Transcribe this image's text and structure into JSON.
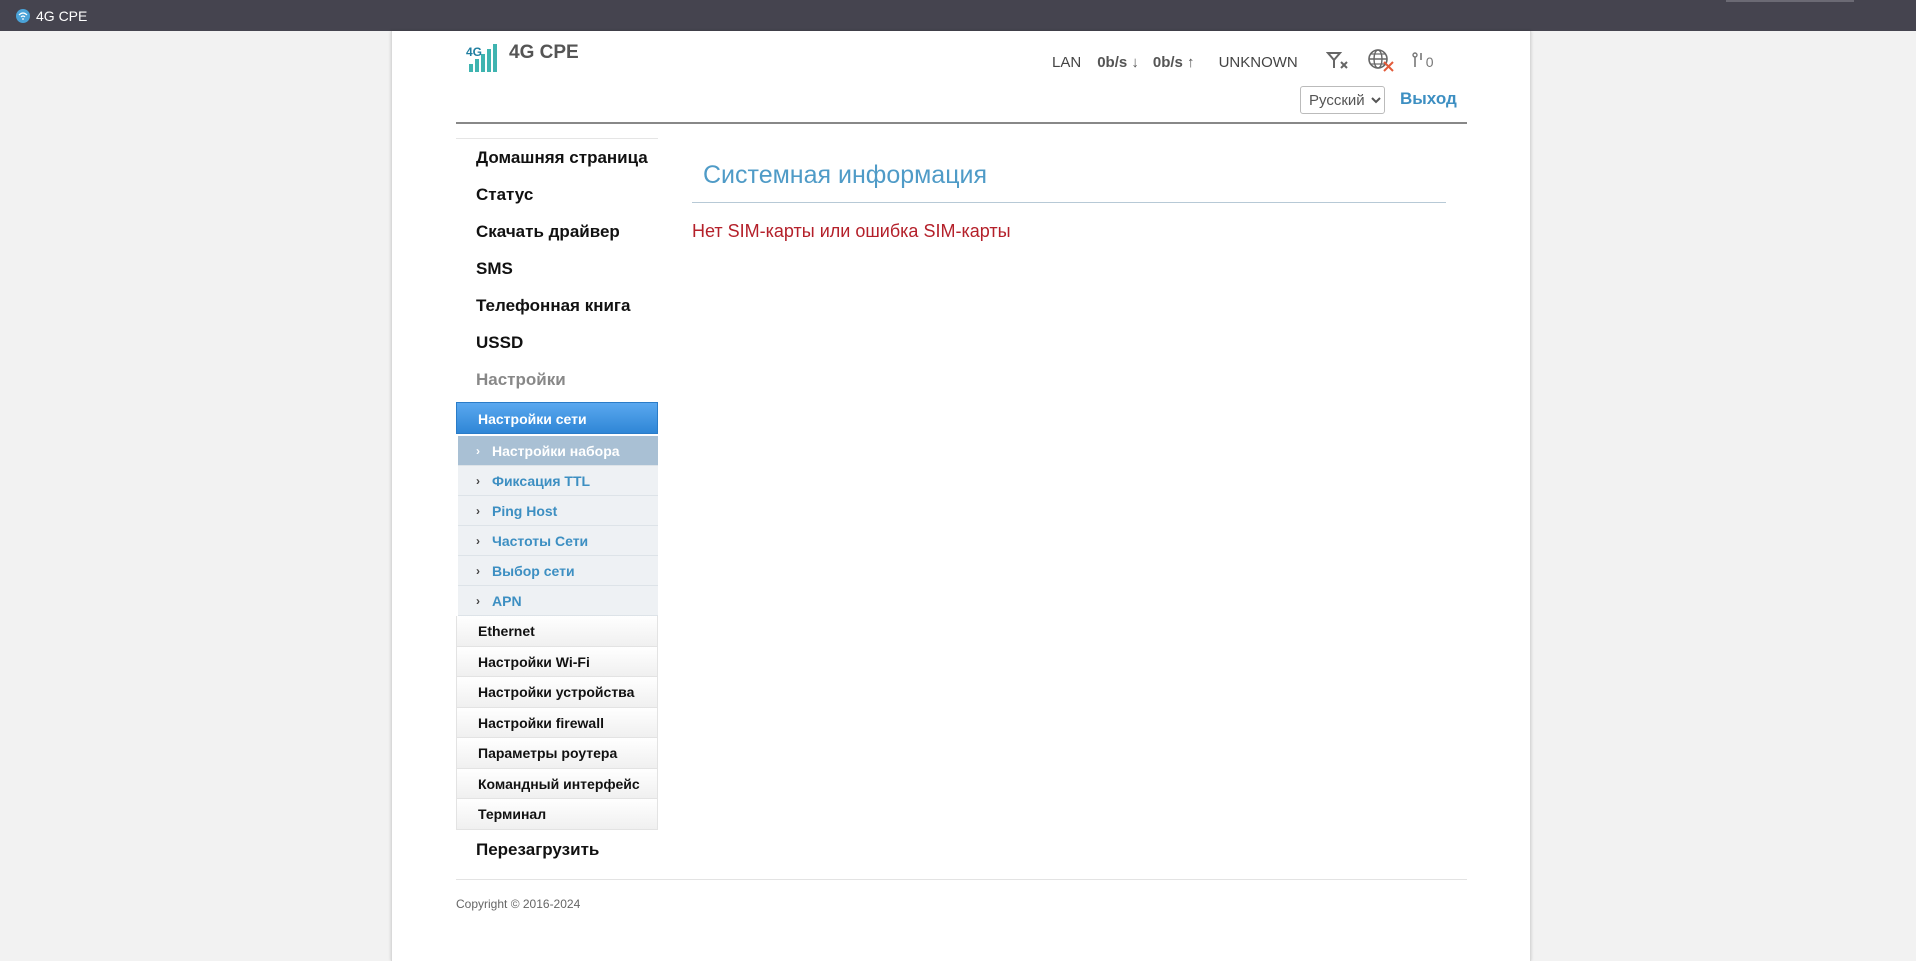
{
  "browser": {
    "tab_title": "4G CPE"
  },
  "header": {
    "logo_text": "4G CPE",
    "status": {
      "connection": "LAN",
      "download": "0b/s ↓",
      "upload": "0b/s ↑",
      "operator": "UNKNOWN",
      "connected_clients": "0"
    },
    "language": {
      "selected": "Русский",
      "options": [
        "Русский"
      ]
    },
    "logout_label": "Выход"
  },
  "sidebar": {
    "top_items": [
      "Домашняя страница",
      "Статус",
      "Скачать драйвер",
      "SMS",
      "Телефонная книга",
      "USSD"
    ],
    "settings_label": "Настройки",
    "network_settings_label": "Настройки сети",
    "network_sub_items": [
      "Настройки набора",
      "Фиксация TTL",
      "Ping Host",
      "Частоты Сети",
      "Выбор сети",
      "APN"
    ],
    "settings_groups": [
      "Ethernet",
      "Настройки Wi-Fi",
      "Настройки устройства",
      "Настройки firewall",
      "Параметры роутера",
      "Командный интерфейс",
      "Терминал"
    ],
    "reboot_label": "Перезагрузить"
  },
  "main": {
    "title": "Системная информация",
    "sim_error": "Нет SIM-карты или ошибка SIM-карты"
  },
  "footer": {
    "copyright": "Copyright © 2016-2024"
  },
  "colors": {
    "accent": "#3d8fc2",
    "title_blue": "#4f9bc7",
    "error_red": "#b4202a",
    "active_menu": "#2f86d6"
  }
}
